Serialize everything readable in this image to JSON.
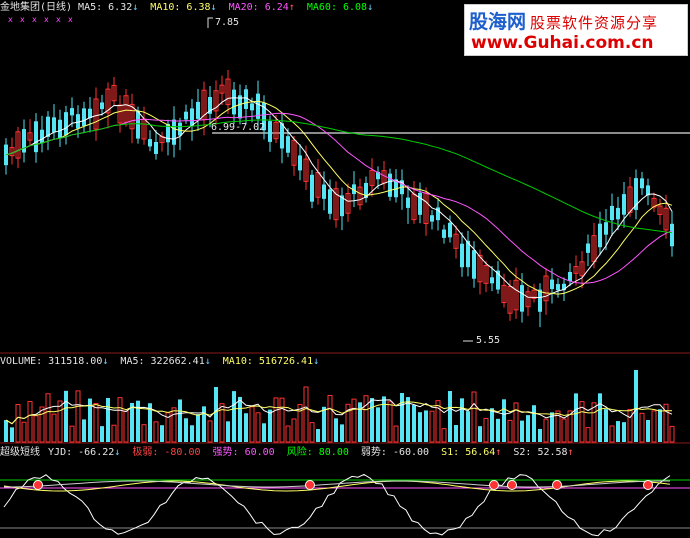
{
  "price_panel": {
    "title": "金地集团(日线)",
    "ma5": "MA5: 6.32",
    "ma10": "MA10: 6.38",
    "ma20": "MA20: 6.24",
    "ma60": "MA60: 6.08",
    "high_label": "7.85",
    "mid_label": "6.99-7.02",
    "low_label": "5.55",
    "colors": {
      "up": "#ff3333",
      "down": "#55e5f5",
      "ma5": "#ffffff",
      "ma10": "#ffff66",
      "ma20": "#ff55ff",
      "ma60": "#00cc00"
    }
  },
  "volume_panel": {
    "volume": "VOLUME: 311518.00",
    "ma5": "MA5: 322662.41",
    "ma10": "MA10: 516726.41"
  },
  "indicator_panel": {
    "title": "超级短线",
    "yjd": "YJD: -66.22",
    "jiruo": "极弱: -80.00",
    "qiangshi": "强势: 60.00",
    "fengxian": "风险: 80.00",
    "ruoshi": "弱势: -60.00",
    "s1": "S1: 56.64",
    "s2": "S2: 52.58"
  },
  "watermark": {
    "brand": "股海网",
    "tagline": "股票软件资源分享",
    "url": "www.Guhai.com.cn"
  }
}
